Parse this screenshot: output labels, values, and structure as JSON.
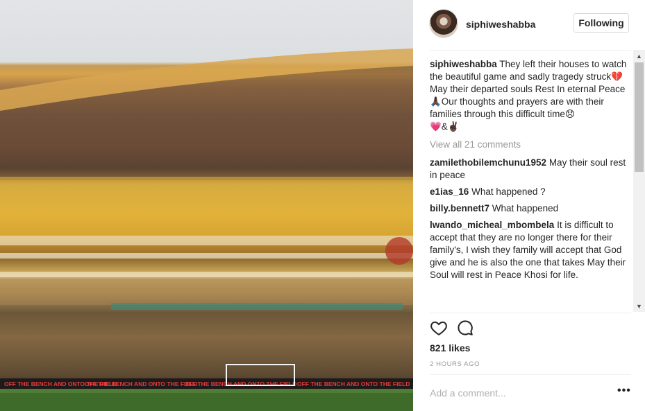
{
  "post": {
    "photo_alt": "stadium crowd photo",
    "photo_banner_text": "OFF THE BENCH AND ONTO THE FIELD"
  },
  "header": {
    "username": "siphiweshabba",
    "follow_label": "Following"
  },
  "caption": {
    "username": "siphiweshabba",
    "text": "They left their houses to watch the beautiful game and sadly tragedy struck💔May their departed souls Rest In eternal Peace🙏🏿Our thoughts and prayers are with their families through this difficult time😞",
    "emoji_line": "💗&✌🏿"
  },
  "view_all_comments": "View all 21 comments",
  "comments": [
    {
      "username": "zamilethobilemchunu1952",
      "text": "May their soul rest in peace"
    },
    {
      "username": "e1ias_16",
      "text": "What happened ?"
    },
    {
      "username": "billy.bennett7",
      "text": "What happened"
    },
    {
      "username": "lwando_micheal_mbombela",
      "text": "It is difficult to accept that they are no longer there for their family's, I wish they family will accept that God give and he is also the one that takes May their Soul will rest in Peace Khosi for life."
    }
  ],
  "likes": "821 likes",
  "timestamp": "2 HOURS AGO",
  "add_comment_placeholder": "Add a comment...",
  "more_label": "•••",
  "icons": {
    "like": "heart-icon",
    "comment": "comment-bubble-icon",
    "scroll_up": "triangle-up-icon",
    "scroll_down": "triangle-down-icon"
  }
}
